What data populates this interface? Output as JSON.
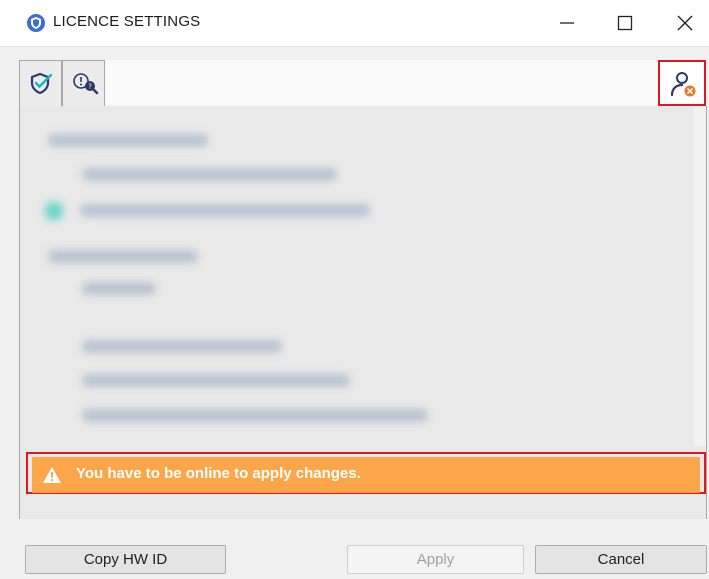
{
  "window": {
    "title": "LICENCE SETTINGS"
  },
  "toolbar": {
    "tabs": [
      {
        "icon": "shield-check-icon"
      },
      {
        "icon": "info-search-icon"
      }
    ],
    "user_button_icon": "user-remove-icon"
  },
  "warning": {
    "text": "You have to be online to apply changes.",
    "color": "#fca64a"
  },
  "buttons": {
    "copy_hw_id": "Copy HW ID",
    "apply": "Apply",
    "cancel": "Cancel"
  },
  "colors": {
    "highlight_frame": "#e0171f",
    "icon_blue": "#2b3a67",
    "icon_orange": "#e8762b"
  }
}
